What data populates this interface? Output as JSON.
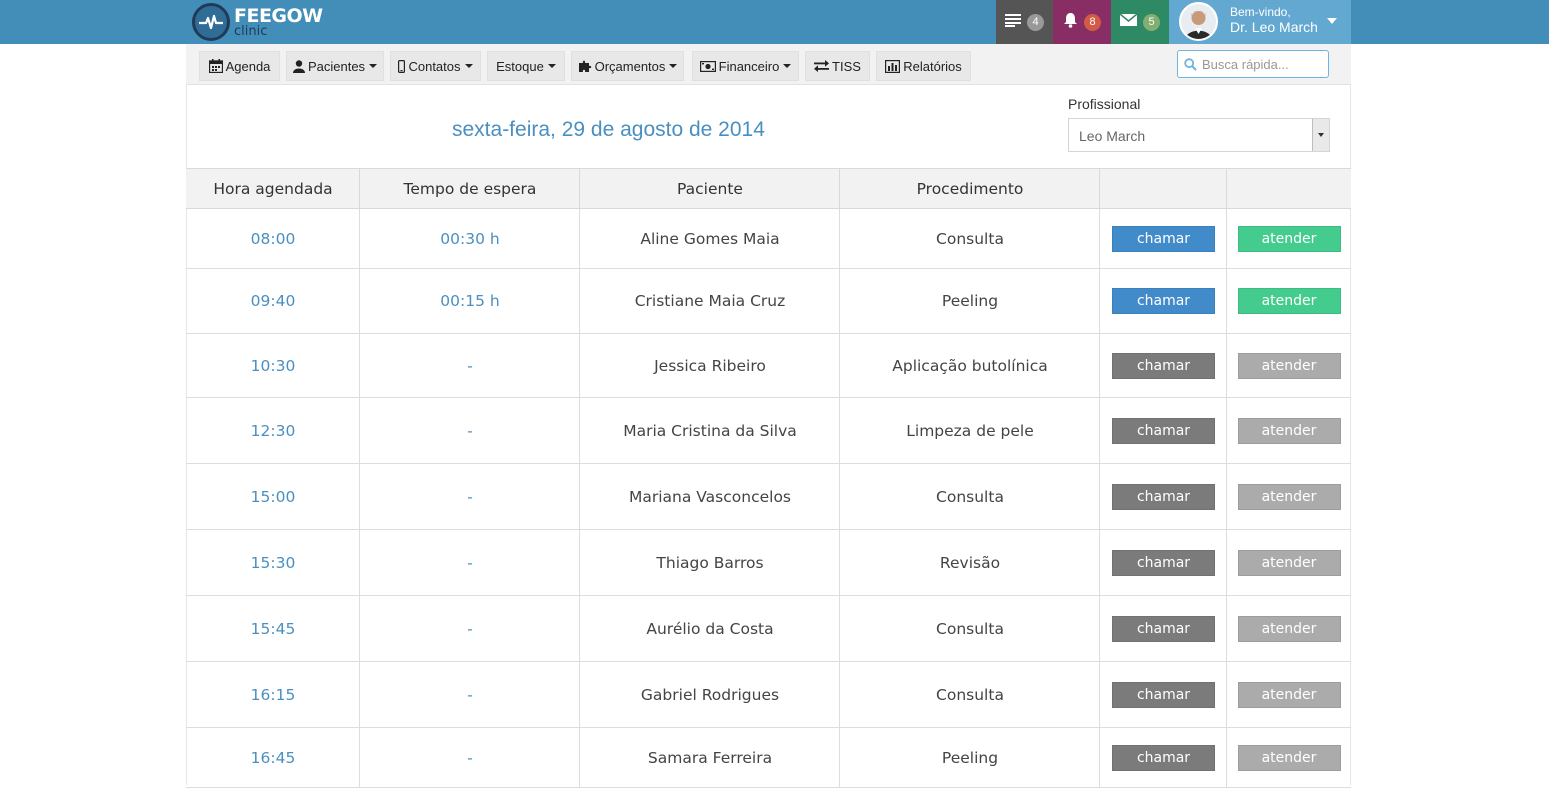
{
  "brand": {
    "name": "FEEGOW",
    "sub": "clinic"
  },
  "topbar": {
    "tasks_count": "4",
    "notifications_count": "8",
    "messages_count": "5",
    "welcome": "Bem-vindo,",
    "username": "Dr. Leo March"
  },
  "colors": {
    "topbar": "#438eb9",
    "tasks": "#555555",
    "notifications": "#892e65",
    "messages": "#2e8965",
    "user": "#62a8d1",
    "chamar_active": "#428bca",
    "atender_active": "#44cc8e",
    "chamar_disabled": "#7b7b7b",
    "atender_disabled": "#ababab"
  },
  "menu": {
    "agenda": "Agenda",
    "pacientes": "Pacientes",
    "contatos": "Contatos",
    "estoque": "Estoque",
    "orcamentos": "Orçamentos",
    "financeiro": "Financeiro",
    "tiss": "TISS",
    "relatorios": "Relatórios"
  },
  "search": {
    "placeholder": "Busca rápida..."
  },
  "page": {
    "date": "sexta-feira, 29 de agosto de 2014",
    "professional_label": "Profissional",
    "professional_value": "Leo March"
  },
  "table": {
    "headers": [
      "Hora agendada",
      "Tempo de espera",
      "Paciente",
      "Procedimento",
      "",
      ""
    ],
    "call_label": "chamar",
    "attend_label": "atender",
    "rows": [
      {
        "time": "08:00",
        "wait": "00:30 h",
        "patient": "Aline Gomes Maia",
        "procedure": "Consulta",
        "active": true
      },
      {
        "time": "09:40",
        "wait": "00:15 h",
        "patient": "Cristiane Maia Cruz",
        "procedure": "Peeling",
        "active": true
      },
      {
        "time": "10:30",
        "wait": "-",
        "patient": "Jessica Ribeiro",
        "procedure": "Aplicação butolínica",
        "active": false
      },
      {
        "time": "12:30",
        "wait": "-",
        "patient": "Maria Cristina da Silva",
        "procedure": "Limpeza de pele",
        "active": false
      },
      {
        "time": "15:00",
        "wait": "-",
        "patient": "Mariana Vasconcelos",
        "procedure": "Consulta",
        "active": false
      },
      {
        "time": "15:30",
        "wait": "-",
        "patient": "Thiago Barros",
        "procedure": "Revisão",
        "active": false
      },
      {
        "time": "15:45",
        "wait": "-",
        "patient": "Aurélio da Costa",
        "procedure": "Consulta",
        "active": false
      },
      {
        "time": "16:15",
        "wait": "-",
        "patient": "Gabriel Rodrigues",
        "procedure": "Consulta",
        "active": false
      },
      {
        "time": "16:45",
        "wait": "-",
        "patient": "Samara Ferreira",
        "procedure": "Peeling",
        "active": false
      }
    ]
  }
}
